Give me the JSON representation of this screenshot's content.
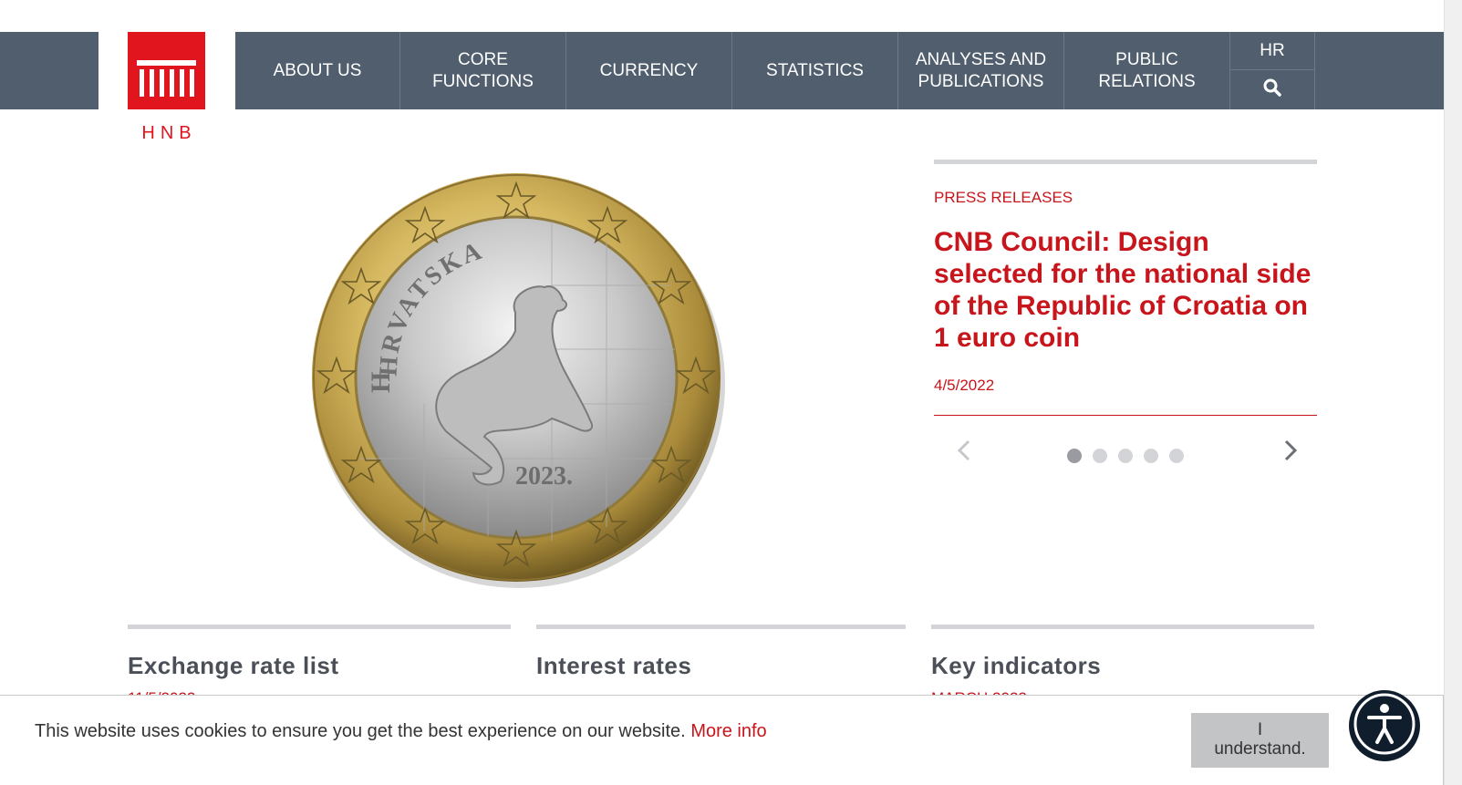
{
  "logo": {
    "text": "HNB"
  },
  "nav": {
    "items": [
      {
        "label": "ABOUT US"
      },
      {
        "label": "CORE FUNCTIONS"
      },
      {
        "label": "CURRENCY"
      },
      {
        "label": "STATISTICS"
      },
      {
        "label": "ANALYSES AND PUBLICATIONS"
      },
      {
        "label": "PUBLIC RELATIONS"
      }
    ],
    "lang": "HR",
    "search_icon": "search-icon"
  },
  "hero": {
    "coin_inscription": "HRVATSKA",
    "coin_year": "2023."
  },
  "press": {
    "category": "PRESS RELEASES",
    "title": "CNB Council: Design selected for the national side of the Republic of Croatia on 1 euro coin",
    "date": "4/5/2022",
    "slide_count": 5,
    "active_slide": 1
  },
  "sections": [
    {
      "title": "Exchange rate list",
      "sub": "11/5/2022"
    },
    {
      "title": "Interest rates",
      "sub": ""
    },
    {
      "title": "Key indicators",
      "sub": "MARCH 2022"
    }
  ],
  "cookie": {
    "text": "This website uses cookies to ensure you get the best experience on our website.",
    "link": "More info",
    "button_line1": "I",
    "button_line2": "understand."
  },
  "accessibility": {
    "icon": "accessibility-icon"
  },
  "colors": {
    "nav_bg": "#515e6e",
    "brand_red": "#e1151e",
    "text_red": "#c8141b",
    "grey_bar": "#d3d4d8"
  }
}
